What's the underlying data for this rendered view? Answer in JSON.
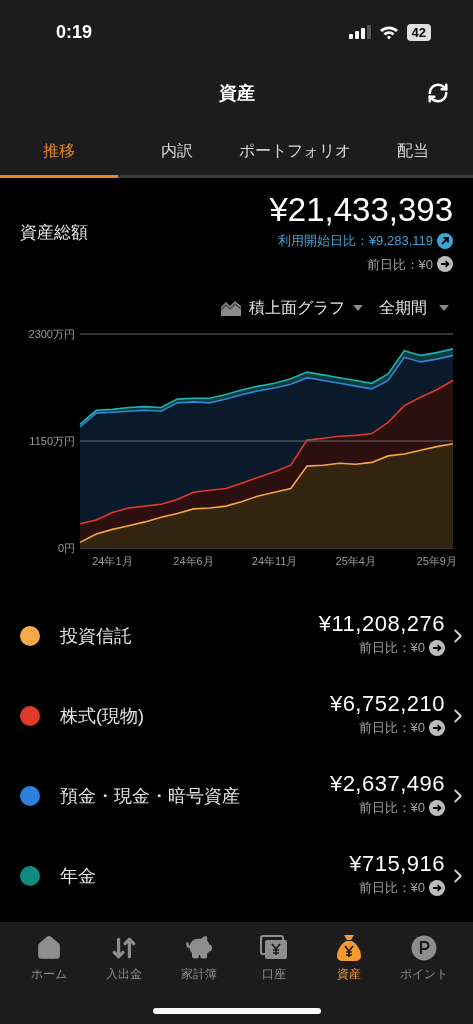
{
  "status_bar": {
    "time": "0:19",
    "battery": "42"
  },
  "header": {
    "title": "資産"
  },
  "tabs": [
    {
      "label": "推移",
      "selected": true
    },
    {
      "label": "内訳",
      "selected": false
    },
    {
      "label": "ポートフォリオ",
      "selected": false
    },
    {
      "label": "配当",
      "selected": false
    }
  ],
  "summary": {
    "label": "資産総額",
    "total": "¥21,433,393",
    "since_start": "利用開始日比：¥9,283,119",
    "day_change": "前日比：¥0"
  },
  "chart_controls": {
    "chart_type": "積上面グラフ",
    "period": "全期間"
  },
  "chart": {
    "chart_data": {
      "type": "area",
      "stacked": true,
      "categories": [
        null,
        null,
        "24年1月",
        null,
        null,
        null,
        null,
        "24年6月",
        null,
        null,
        null,
        null,
        "24年11月",
        null,
        null,
        null,
        null,
        "25年4月",
        null,
        null,
        null,
        null,
        "25年9月",
        null
      ],
      "ylim": [
        0,
        2300
      ],
      "yticks": [
        {
          "value": 0,
          "label": "0円"
        },
        {
          "value": 1150,
          "label": "1150万円"
        },
        {
          "value": 2300,
          "label": "2300万円"
        }
      ],
      "series": [
        {
          "color": "#f5a742",
          "values": [
            60,
            150,
            200,
            240,
            280,
            330,
            370,
            420,
            430,
            450,
            500,
            560,
            600,
            640,
            880,
            890,
            910,
            900,
            920,
            990,
            1010,
            1050,
            1090,
            1120
          ]
        },
        {
          "color": "#e0392b",
          "values": [
            200,
            150,
            180,
            190,
            170,
            140,
            150,
            180,
            190,
            190,
            200,
            200,
            220,
            250,
            280,
            290,
            290,
            310,
            310,
            360,
            520,
            570,
            610,
            680
          ]
        },
        {
          "color": "#2f86d6",
          "values": [
            1040,
            1150,
            1080,
            1040,
            1030,
            1000,
            1040,
            970,
            940,
            960,
            950,
            930,
            900,
            870,
            670,
            620,
            570,
            530,
            480,
            450,
            520,
            380,
            330,
            270
          ]
        },
        {
          "color": "#1bb3b0",
          "values": [
            30,
            30,
            30,
            40,
            40,
            40,
            40,
            40,
            50,
            50,
            50,
            50,
            50,
            60,
            60,
            60,
            60,
            60,
            60,
            70,
            70,
            70,
            70,
            70
          ]
        }
      ]
    }
  },
  "categories": [
    {
      "name": "投資信託",
      "color": "#f9a94a",
      "amount": "¥11,208,276",
      "day_change": "前日比：¥0"
    },
    {
      "name": "株式(現物)",
      "color": "#e03a2c",
      "amount": "¥6,752,210",
      "day_change": "前日比：¥0"
    },
    {
      "name": "預金・現金・暗号資産",
      "color": "#2d80dc",
      "amount": "¥2,637,496",
      "day_change": "前日比：¥0"
    },
    {
      "name": "年金",
      "color": "#0f8a80",
      "amount": "¥715,916",
      "day_change": "前日比：¥0"
    }
  ],
  "nav": [
    {
      "kind": "home",
      "label": "ホーム",
      "selected": false
    },
    {
      "kind": "transfer",
      "label": "入出金",
      "selected": false
    },
    {
      "kind": "piggy",
      "label": "家計簿",
      "selected": false
    },
    {
      "kind": "account",
      "label": "口座",
      "selected": false
    },
    {
      "kind": "assets",
      "label": "資産",
      "selected": true
    },
    {
      "kind": "points",
      "label": "ポイント",
      "selected": false
    }
  ]
}
